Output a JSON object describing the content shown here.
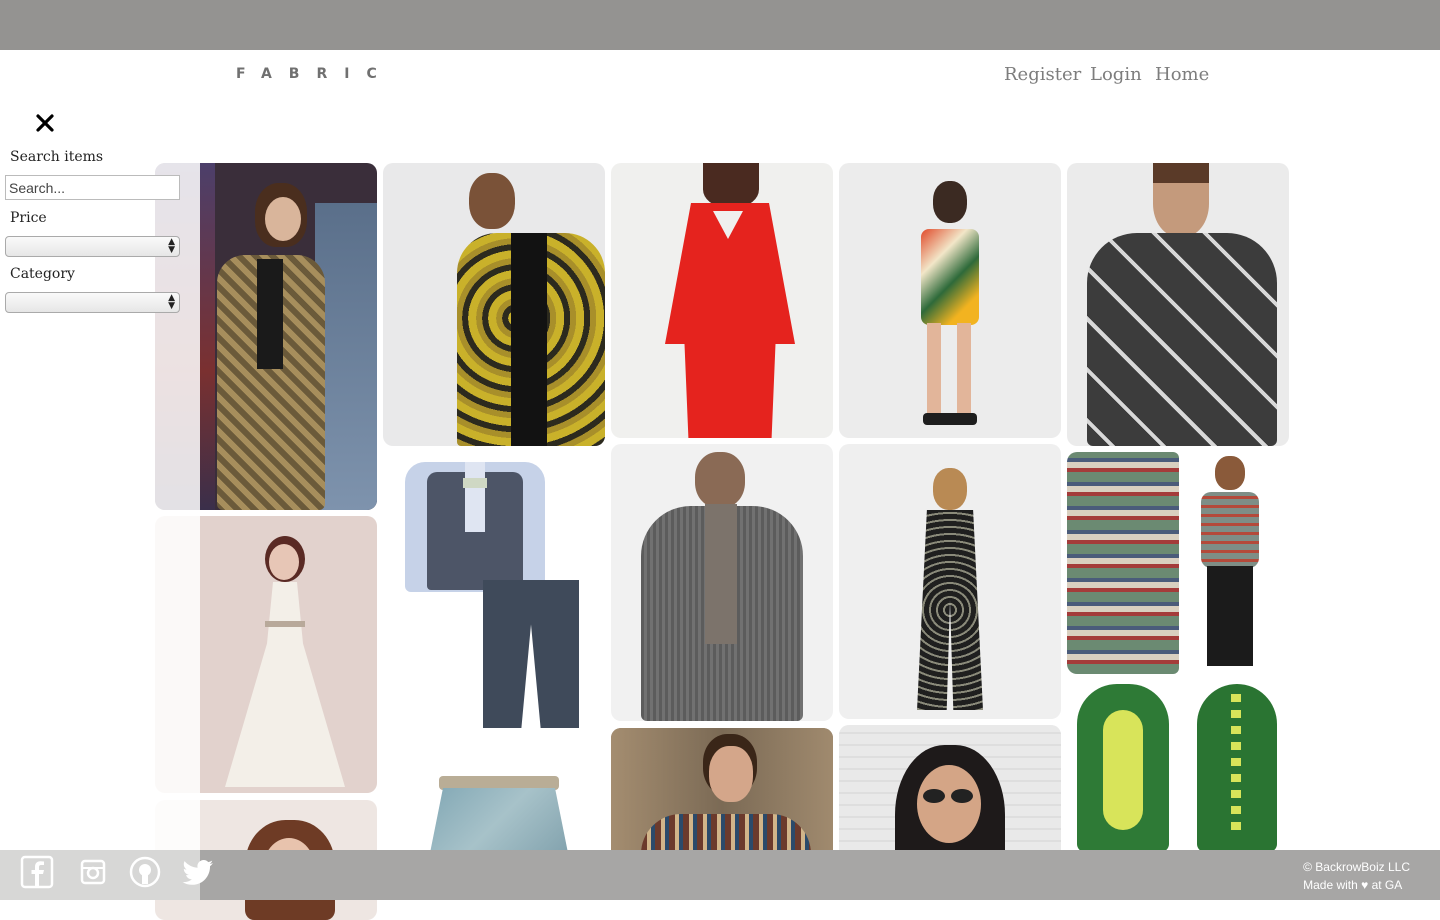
{
  "header": {
    "brand": "FABRIC",
    "nav": {
      "register": "Register",
      "login": "Login",
      "home": "Home"
    }
  },
  "sidebar": {
    "search_label": "Search items",
    "search_placeholder": "Search...",
    "price_label": "Price",
    "category_label": "Category",
    "price_value": "",
    "category_value": ""
  },
  "grid": {
    "items": [
      {
        "name": "patterned-suit-man",
        "bg": "#3a2e3a"
      },
      {
        "name": "printed-bomber-jacket",
        "bg": "#e9e9ea"
      },
      {
        "name": "red-suit",
        "bg": "#f0f0ee"
      },
      {
        "name": "floral-playsuit",
        "bg": "#ececec"
      },
      {
        "name": "rocket-print-sweater",
        "bg": "#ebebeb"
      },
      {
        "name": "white-gown",
        "bg": "#e2d2cd"
      },
      {
        "name": "boys-waistcoat-set",
        "bg": "#ffffff"
      },
      {
        "name": "grey-knit-cardigan",
        "bg": "#f1f1f1"
      },
      {
        "name": "floral-jumpsuit",
        "bg": "#efefef"
      },
      {
        "name": "fair-isle-cardigan",
        "bg": "#ffffff"
      },
      {
        "name": "woman-hair-portrait",
        "bg": "#eee6e2"
      },
      {
        "name": "printed-skirt",
        "bg": "#ffffff"
      },
      {
        "name": "man-shawl-cardigan",
        "bg": "#8e7a62"
      },
      {
        "name": "woman-sunglasses",
        "bg": "#eeeeee"
      },
      {
        "name": "dinosaur-onesie",
        "bg": "#ffffff"
      }
    ]
  },
  "footer": {
    "copyright": "© BackrowBoiz LLC",
    "made_with": "Made with ♥ at GA"
  },
  "colors": {
    "topbar": "#949391",
    "footer": "#a7a6a5",
    "nav_text": "#7d7d7d"
  }
}
